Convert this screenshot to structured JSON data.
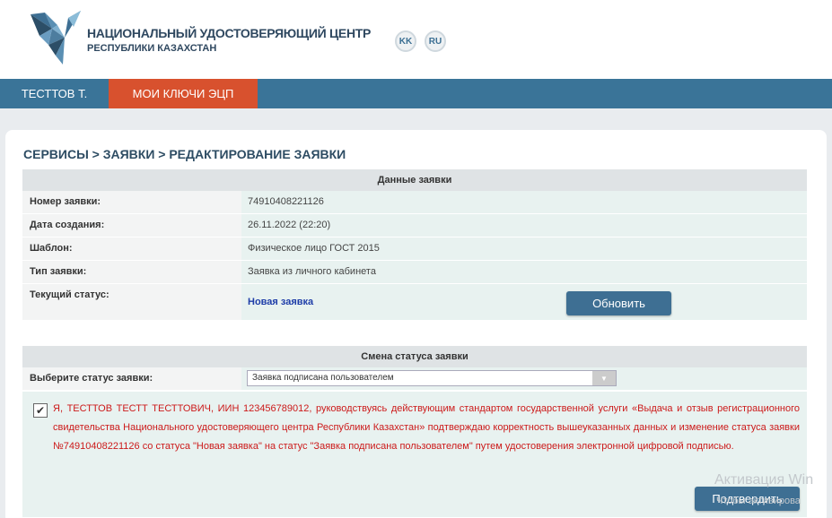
{
  "header": {
    "org_name": "НАЦИОНАЛЬНЫЙ УДОСТОВЕРЯЮЩИЙ ЦЕНТР",
    "org_sub": "РЕСПУБЛИКИ КАЗАХСТАН",
    "lang_kk": "KK",
    "lang_ru": "RU"
  },
  "nav": {
    "user": "ТЕСТТОВ Т.",
    "keys": "МОИ КЛЮЧИ ЭЦП"
  },
  "breadcrumb": "СЕРВИСЫ > ЗАЯВКИ > РЕДАКТИРОВАНИЕ ЗАЯВКИ",
  "request": {
    "section_title": "Данные заявки",
    "rows": [
      {
        "label": "Номер заявки:",
        "value": "74910408221126"
      },
      {
        "label": "Дата создания:",
        "value": "26.11.2022 (22:20)"
      },
      {
        "label": "Шаблон:",
        "value": "Физическое лицо ГОСТ 2015"
      },
      {
        "label": "Тип заявки:",
        "value": "Заявка из личного кабинета"
      }
    ],
    "status_label": "Текущий статус:",
    "status_value": "Новая заявка",
    "update_button": "Обновить"
  },
  "status_change": {
    "section_title": "Смена статуса заявки",
    "select_label": "Выберите статус заявки:",
    "selected": "Заявка подписана пользователем",
    "consent_text": "Я, ТЕСТТОВ ТЕСТТ ТЕСТТОВИЧ, ИИН 123456789012, руководствуясь действующим стандартом государственной услуги «Выдача и отзыв регистрационного свидетельства Национального удостоверяющего центра Республики Казахстан» подтверждаю корректность вышеуказанных данных и изменение статуса заявки №74910408221126 со статуса \"Новая заявка\" на статус \"Заявка подписана пользователем\" путем удостоверения электронной цифровой подписью.",
    "confirm_button": "Подтвердить"
  },
  "watermark": {
    "line1": "Активация Win",
    "line2": "Чтобы активирова"
  },
  "colors": {
    "nav": "#3a7498",
    "nav_active": "#d8512e",
    "button": "#3e6f93",
    "consent_text": "#cc1a1a"
  }
}
